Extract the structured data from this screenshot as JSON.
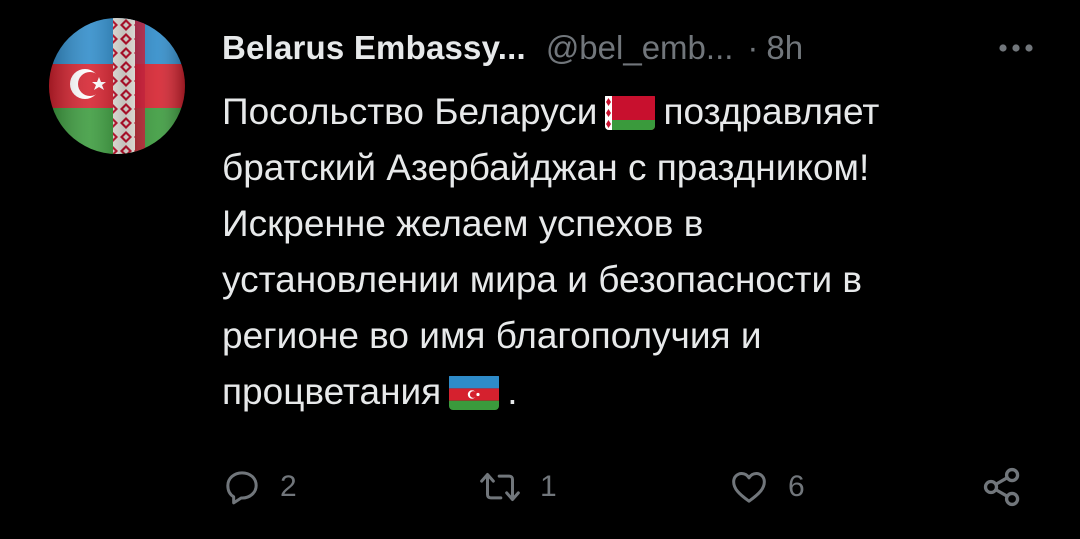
{
  "author": {
    "display_name": "Belarus Embassy...",
    "handle": "@bel_emb...",
    "separator": "·",
    "time": "8h",
    "avatar_icon": "azerbaijan-belarus-flag-avatar"
  },
  "tweet": {
    "lines": [
      {
        "before": "Посольство Беларуси",
        "flag": "belarus-flag",
        "after": "поздравляет"
      },
      {
        "text": "братский Азербайджан с праздником!"
      },
      {
        "text": "Искренне желаем успехов в"
      },
      {
        "text": "установлении мира и безопасности в"
      },
      {
        "text": "регионе во имя благополучия и"
      },
      {
        "before": "процветания",
        "flag": "azerbaijan-flag",
        "after": "."
      }
    ]
  },
  "actions": {
    "reply_count": "2",
    "retweet_count": "1",
    "like_count": "6"
  },
  "colors": {
    "background": "#000000",
    "text_primary": "#e7e9ea",
    "text_secondary": "#71767b"
  }
}
